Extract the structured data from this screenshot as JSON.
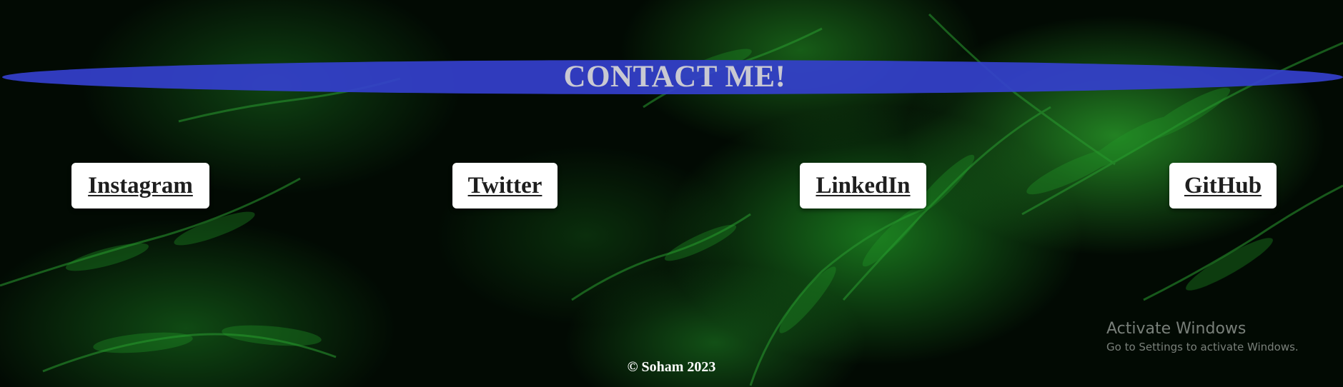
{
  "header": {
    "title": "CONTACT ME!"
  },
  "links": {
    "instagram": "Instagram",
    "twitter": "Twitter",
    "linkedin": "LinkedIn",
    "github": "GitHub"
  },
  "footer": {
    "copyright": "© Soham 2023"
  },
  "watermark": {
    "title": "Activate Windows",
    "subtitle": "Go to Settings to activate Windows."
  },
  "colors": {
    "banner": "#3440cd",
    "banner_text": "#c9c9d2",
    "button_bg": "#ffffff",
    "button_text": "#1e1e1e",
    "foliage": "#1e8c23"
  }
}
